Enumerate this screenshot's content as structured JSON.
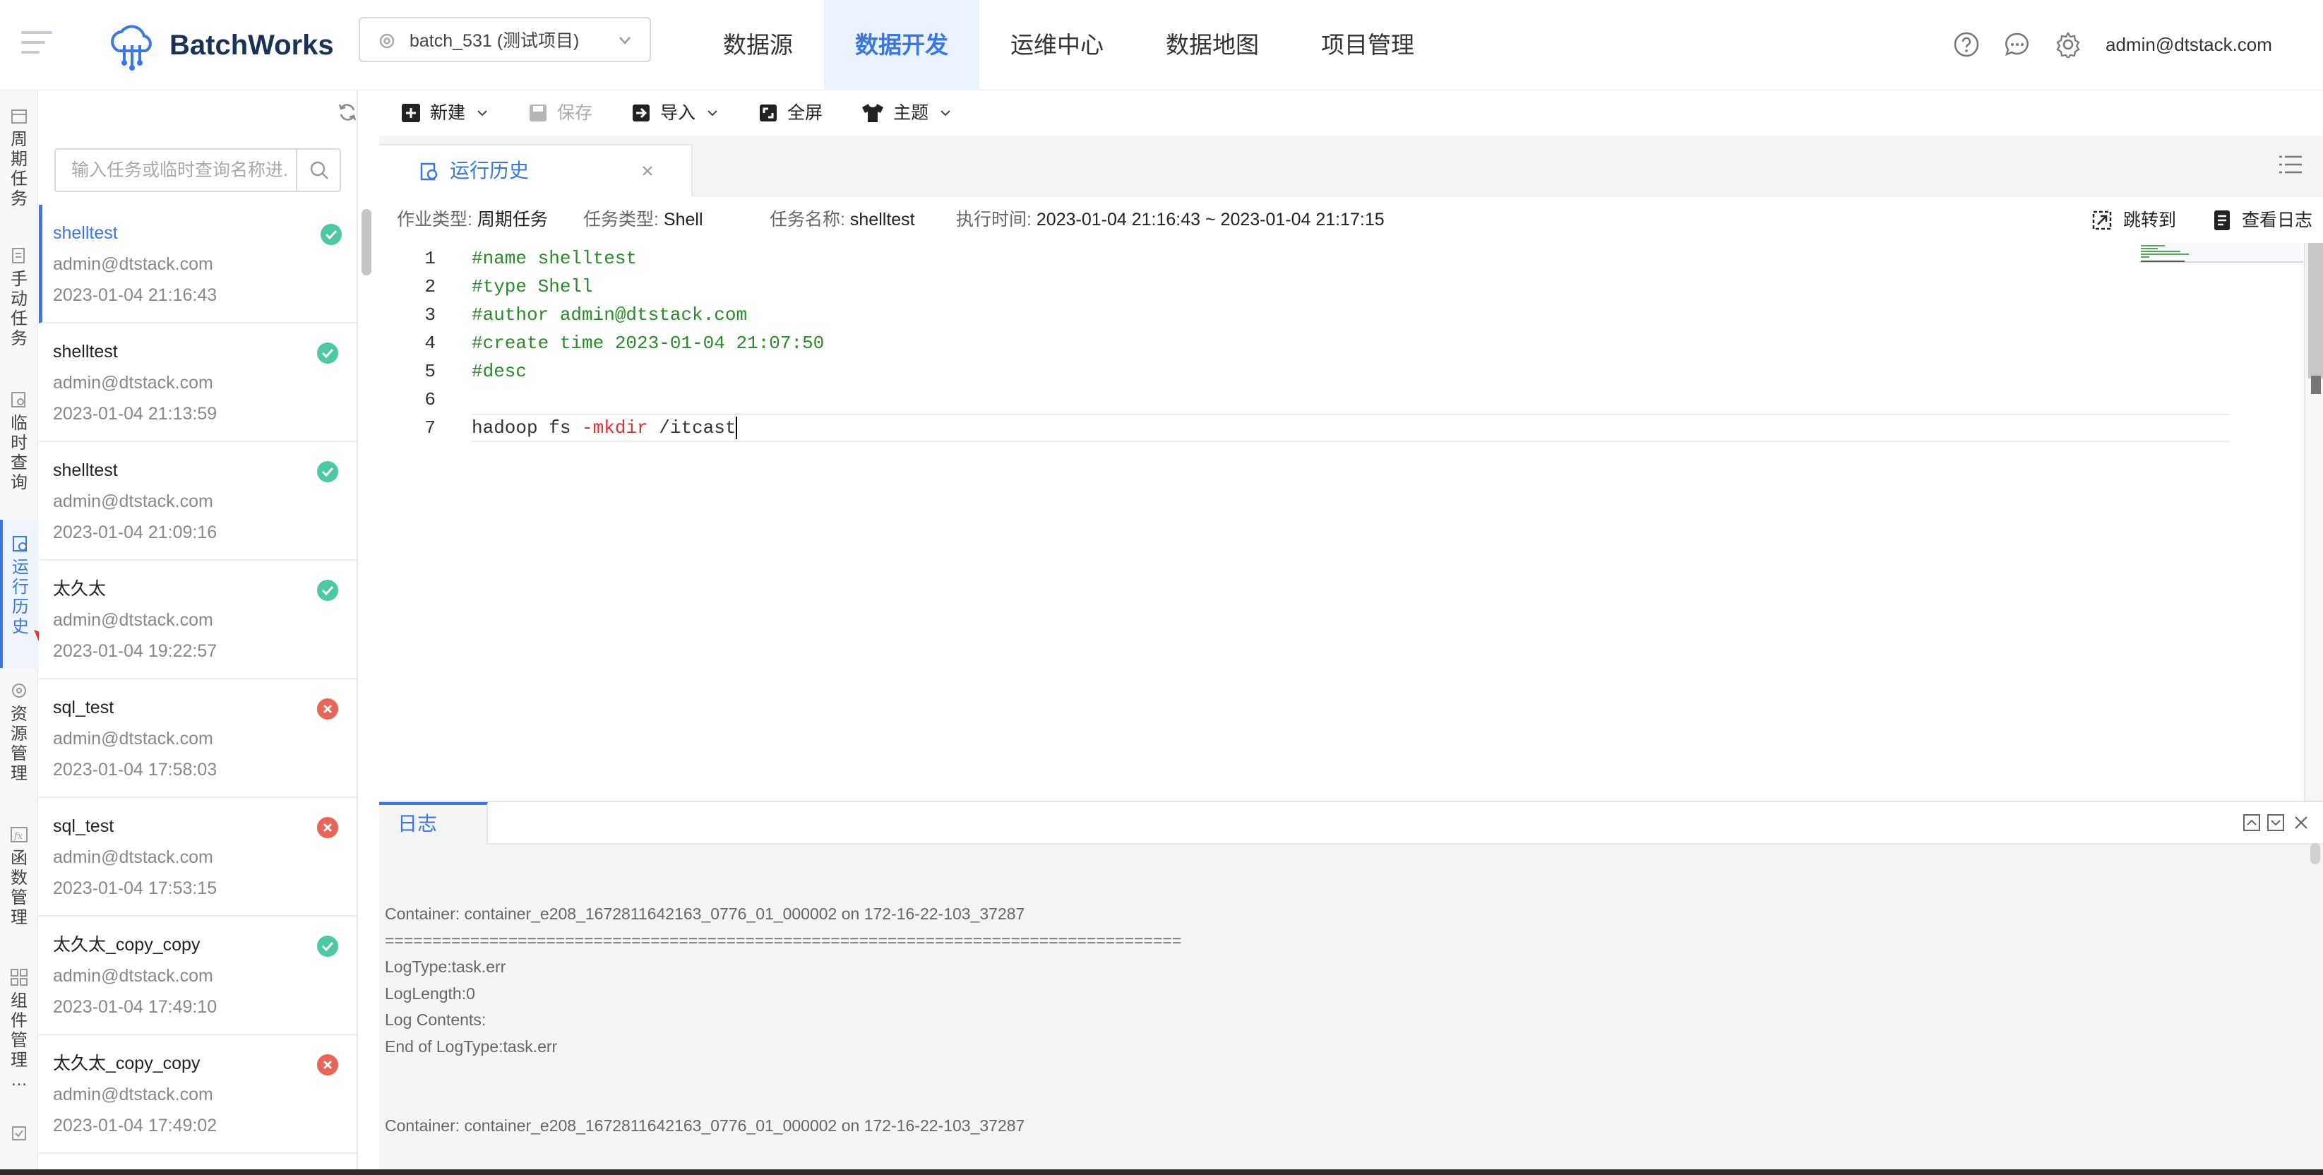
{
  "app": {
    "name": "BatchWorks"
  },
  "project": {
    "selected": "batch_531 (测试项目)"
  },
  "nav": [
    {
      "label": "数据源"
    },
    {
      "label": "数据开发"
    },
    {
      "label": "运维中心"
    },
    {
      "label": "数据地图"
    },
    {
      "label": "项目管理"
    }
  ],
  "user": {
    "email": "admin@dtstack.com"
  },
  "rail": [
    {
      "label": "周期任务",
      "icon": "calendar-icon"
    },
    {
      "label": "手动任务",
      "icon": "manual-task-icon"
    },
    {
      "label": "临时查询",
      "icon": "query-icon"
    },
    {
      "label": "运行历史",
      "icon": "history-icon"
    },
    {
      "label": "资源管理",
      "icon": "resource-icon"
    },
    {
      "label": "函数管理",
      "icon": "function-icon"
    },
    {
      "label": "组件管理",
      "icon": "component-icon"
    },
    {
      "label": "…",
      "icon": "more-icon"
    }
  ],
  "search": {
    "placeholder": "输入任务或临时查询名称进..."
  },
  "history": [
    {
      "name": "shelltest",
      "user": "admin@dtstack.com",
      "time": "2023-01-04 21:16:43",
      "status": "success"
    },
    {
      "name": "shelltest",
      "user": "admin@dtstack.com",
      "time": "2023-01-04 21:13:59",
      "status": "success"
    },
    {
      "name": "shelltest",
      "user": "admin@dtstack.com",
      "time": "2023-01-04 21:09:16",
      "status": "success"
    },
    {
      "name": "太久太",
      "user": "admin@dtstack.com",
      "time": "2023-01-04 19:22:57",
      "status": "success"
    },
    {
      "name": "sql_test",
      "user": "admin@dtstack.com",
      "time": "2023-01-04 17:58:03",
      "status": "failed"
    },
    {
      "name": "sql_test",
      "user": "admin@dtstack.com",
      "time": "2023-01-04 17:53:15",
      "status": "failed"
    },
    {
      "name": "太久太_copy_copy",
      "user": "admin@dtstack.com",
      "time": "2023-01-04 17:49:10",
      "status": "success"
    },
    {
      "name": "太久太_copy_copy",
      "user": "admin@dtstack.com",
      "time": "2023-01-04 17:49:02",
      "status": "failed"
    }
  ],
  "toolbar": {
    "new_label": "新建",
    "save_label": "保存",
    "import_label": "导入",
    "fullscreen_label": "全屏",
    "theme_label": "主题"
  },
  "tab": {
    "label": "运行历史"
  },
  "info": {
    "job_type_label": "作业类型:",
    "job_type": "周期任务",
    "task_type_label": "任务类型:",
    "task_type": "Shell",
    "task_name_label": "任务名称:",
    "task_name": "shelltest",
    "exec_time_label": "执行时间:",
    "exec_time": "2023-01-04 21:16:43 ~ 2023-01-04 21:17:15",
    "goto_label": "跳转到",
    "view_log_label": "查看日志"
  },
  "code": {
    "line_numbers": [
      "1",
      "2",
      "3",
      "4",
      "5",
      "6",
      "7"
    ],
    "lines": [
      "#name shelltest",
      "#type Shell",
      "#author admin@dtstack.com",
      "#create time 2023-01-04 21:07:50",
      "#desc",
      ""
    ],
    "line7_cmd": "hadoop fs ",
    "line7_flag": "-mkdir",
    "line7_arg": " /itcast"
  },
  "log": {
    "tab_label": "日志",
    "lines": [
      "Container: container_e208_1672811642163_0776_01_000002 on 172-16-22-103_37287",
      "====================================================================================",
      "LogType:task.err",
      "LogLength:0",
      "Log Contents:",
      "End of LogType:task.err",
      "",
      "",
      "Container: container_e208_1672811642163_0776_01_000002 on 172-16-22-103_37287"
    ]
  },
  "colors": {
    "accent": "#3a77e0",
    "success": "#4cc9a4",
    "failed": "#e8655a",
    "comment": "#2a8a2a",
    "flag": "#e03030"
  }
}
